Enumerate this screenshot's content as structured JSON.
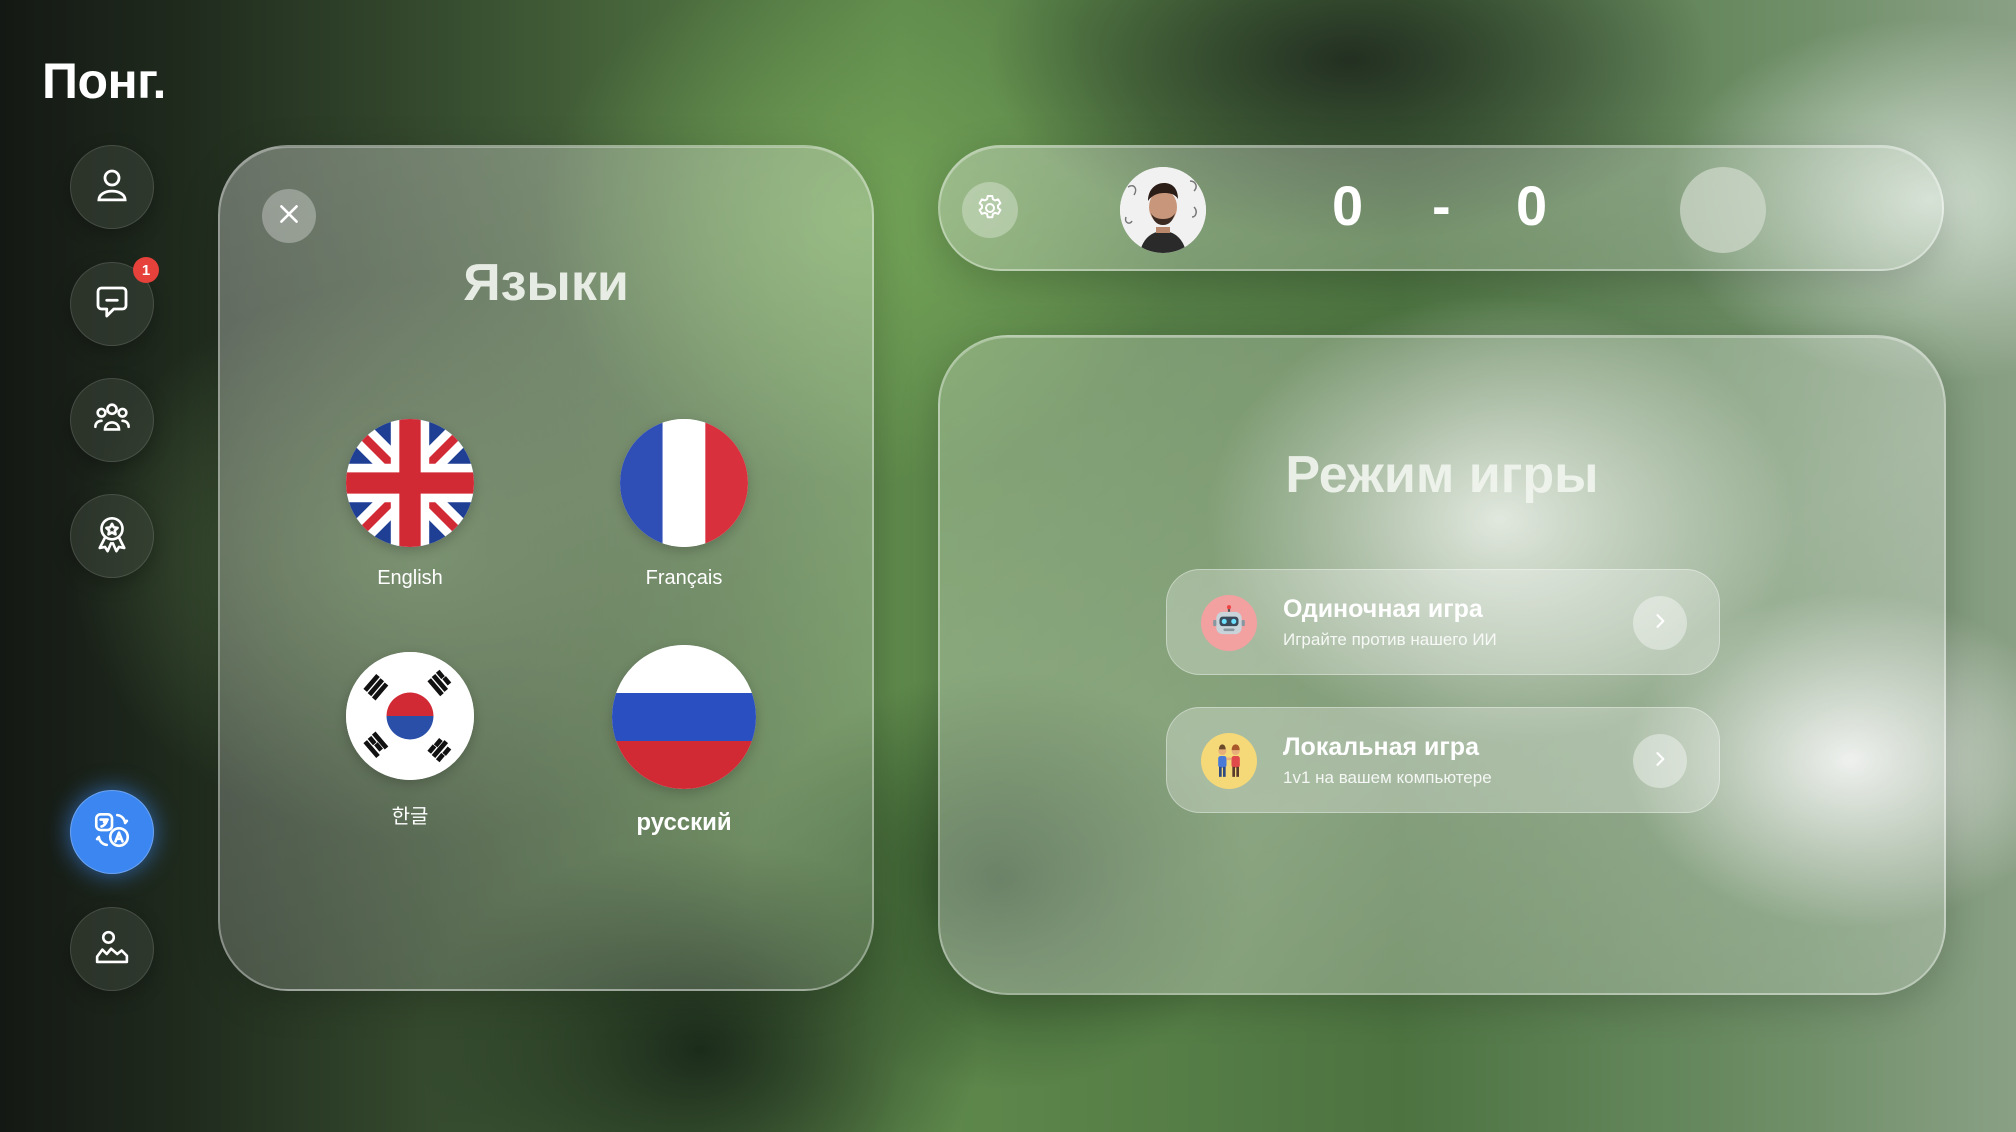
{
  "app": {
    "title": "Понг."
  },
  "sidebar": {
    "items": [
      {
        "name": "profile",
        "icon": "user-icon"
      },
      {
        "name": "chat",
        "icon": "chat-icon",
        "badge": "1"
      },
      {
        "name": "friends",
        "icon": "users-icon"
      },
      {
        "name": "achievements",
        "icon": "award-icon"
      },
      {
        "name": "languages",
        "icon": "translate-icon",
        "active": true
      },
      {
        "name": "logout",
        "icon": "hand-wave-icon"
      }
    ]
  },
  "languages_panel": {
    "title": "Языки",
    "items": [
      {
        "code": "en",
        "label": "English",
        "flag": "uk-flag-icon"
      },
      {
        "code": "fr",
        "label": "Français",
        "flag": "france-flag-icon"
      },
      {
        "code": "ko",
        "label": "한글",
        "flag": "korea-flag-icon"
      },
      {
        "code": "ru",
        "label": "русский",
        "flag": "russia-flag-icon",
        "selected": true
      }
    ]
  },
  "score_bar": {
    "left_score": "0",
    "separator": "-",
    "right_score": "0"
  },
  "game_mode": {
    "title": "Режим игры",
    "modes": [
      {
        "name": "Одиночная игра",
        "description": "Играйте против нашего ИИ",
        "icon": "robot-icon"
      },
      {
        "name": "Локальная игра",
        "description": "1v1 на вашем компьютере",
        "icon": "two-players-icon"
      }
    ]
  },
  "colors": {
    "accent": "#3b86f0",
    "badge": "#e6413a"
  }
}
